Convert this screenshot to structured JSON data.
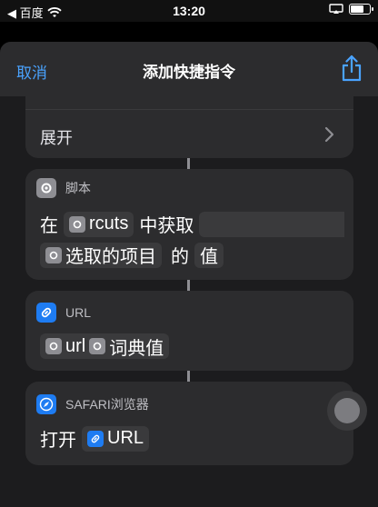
{
  "status_bar": {
    "back_label": "◀ 百度",
    "time": "13:20"
  },
  "nav": {
    "cancel_label": "取消",
    "title": "添加快捷指令",
    "share_icon": "share-icon"
  },
  "expand": {
    "label": "展开"
  },
  "script_action": {
    "header": "脚本",
    "line1": {
      "prefix": "在",
      "token": "rcuts",
      "suffix": "中获取"
    },
    "line2": {
      "token": "选取的项目",
      "middle": "的",
      "suffix": "值"
    }
  },
  "url_action": {
    "header": "URL",
    "token1": "url",
    "token2": "词典值"
  },
  "safari_action": {
    "header": "SAFARI浏览器",
    "verb": "打开",
    "token": "URL"
  },
  "colors": {
    "accent": "#4aa3ff",
    "card": "#2c2c2e",
    "background": "#1c1c1e"
  }
}
